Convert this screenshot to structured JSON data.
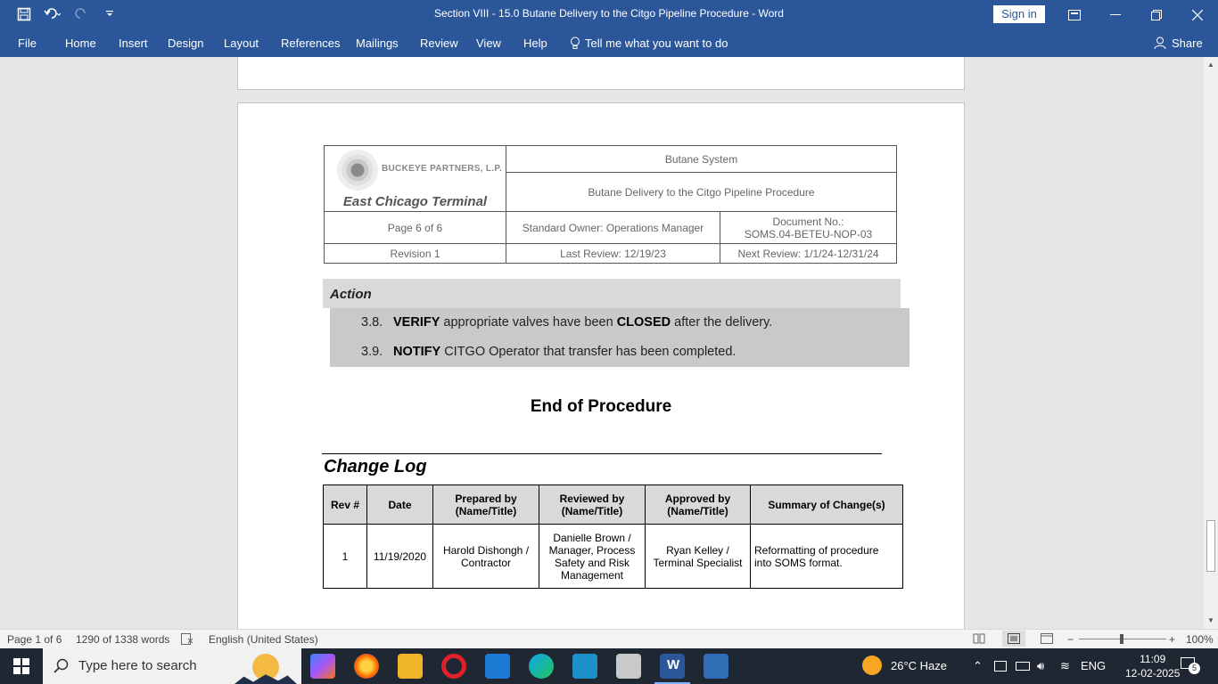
{
  "window": {
    "title": "Section VIII - 15.0 Butane Delivery to the Citgo Pipeline Procedure  -  Word",
    "sign_in": "Sign in"
  },
  "ribbon": {
    "tabs": [
      "File",
      "Home",
      "Insert",
      "Design",
      "Layout",
      "References",
      "Mailings",
      "Review",
      "View",
      "Help"
    ],
    "tell_me": "Tell me what you want to do",
    "share": "Share"
  },
  "header": {
    "company": "BUCKEYE PARTNERS, L.P.",
    "terminal": "East Chicago Terminal",
    "system": "Butane System",
    "procedure": "Butane Delivery to the Citgo Pipeline Procedure",
    "page": "Page 6 of 6",
    "owner": "Standard Owner: Operations Manager",
    "doc_no_label": "Document No.:",
    "doc_no": "SOMS.04-BETEU-NOP-03",
    "revision": "Revision 1",
    "last_review": "Last Review: 12/19/23",
    "next_review": "Next Review: 1/1/24-12/31/24"
  },
  "action": {
    "heading": "Action",
    "steps": [
      {
        "num": "3.8.",
        "verb": "VERIFY",
        "mid": " appropriate valves have been ",
        "bold2": "CLOSED",
        "tail": " after the delivery."
      },
      {
        "num": "3.9.",
        "verb": "NOTIFY",
        "mid": " CITGO Operator that transfer has been completed.",
        "bold2": "",
        "tail": ""
      }
    ]
  },
  "end_of_procedure": "End of Procedure",
  "change_log": {
    "title": "Change Log",
    "headers": [
      "Rev #",
      "Date",
      "Prepared by (Name/Title)",
      "Reviewed by (Name/Title)",
      "Approved by (Name/Title)",
      "Summary of Change(s)"
    ],
    "rows": [
      [
        "1",
        "11/19/2020",
        "Harold Dishongh / Contractor",
        "Danielle Brown / Manager, Process Safety and Risk Management",
        "Ryan Kelley / Terminal Specialist",
        "Reformatting of procedure into SOMS format."
      ]
    ]
  },
  "status": {
    "page": "Page 1 of 6",
    "words": "1290 of 1338 words",
    "language": "English (United States)",
    "zoom": "100%"
  },
  "taskbar": {
    "search_placeholder": "Type here to search",
    "weather": "26°C  Haze",
    "lang": "ENG",
    "time": "11:09",
    "date": "12-02-2025",
    "notifications": "5"
  }
}
